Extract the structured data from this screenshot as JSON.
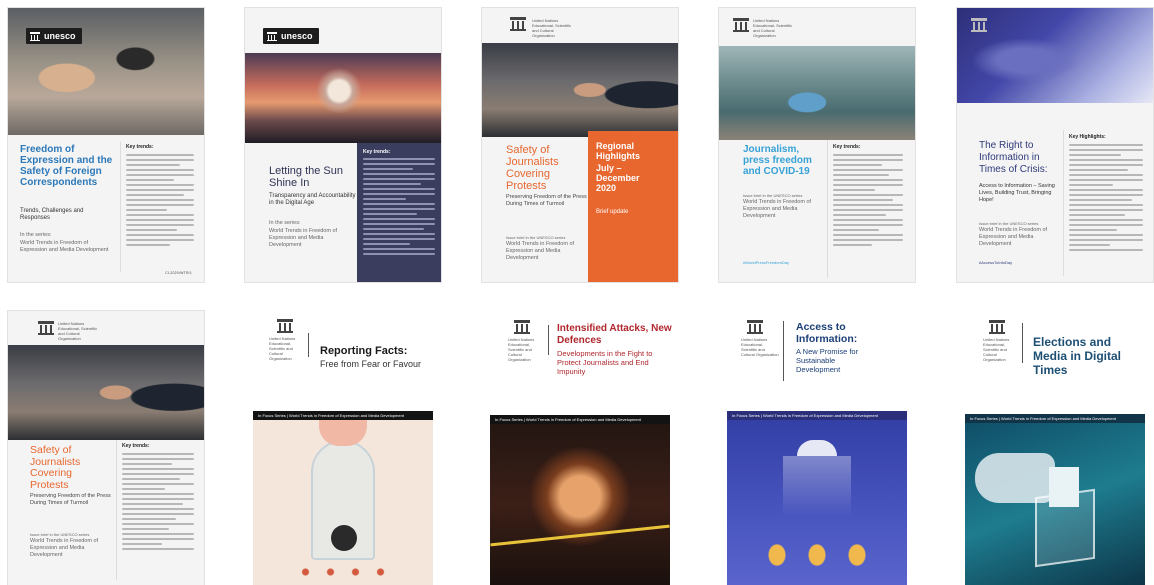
{
  "brand": {
    "logo_text": "unesco",
    "org_lines": "United Nations Educational, Scientific and Cultural Organization"
  },
  "common": {
    "key_trends": "Key trends:",
    "key_highlights": "Key Highlights:",
    "in_series": "In the series:",
    "series_name": "World Trends in Freedom of Expression and Media Development",
    "issue_brief": "Issue brief in the UNESCO series",
    "in_focus_banner": "In Focus Series | World Trends in Freedom of Expression and Media Development",
    "footer": "CI-2020/WTR/1"
  },
  "covers": [
    {
      "title": "Freedom of Expression and the Safety of Foreign Correspondents",
      "subtitle": "Trends, Challenges and Responses"
    },
    {
      "title": "Letting the Sun Shine In",
      "subtitle": "Transparency and Accountability in the Digital Age"
    },
    {
      "title": "Safety of Journalists Covering Protests",
      "subtitle": "Preserving Freedom of the Press During Times of Turmoil",
      "panel_title": "Regional Highlights",
      "panel_date": "July – December 2020",
      "panel_tag": "Brief update"
    },
    {
      "title": "Journalism, press freedom and COVID-19",
      "hashtag": "#WorldPressFreedomDay"
    },
    {
      "title": "The Right to Information in Times of Crisis:",
      "subtitle": "Access to Information – Saving Lives, Building Trust, Bringing Hope!",
      "hashtag": "#AccessToInfoDay"
    },
    {
      "title": "Safety of Journalists Covering Protests",
      "subtitle": "Preserving Freedom of the Press During Times of Turmoil"
    },
    {
      "title": "Reporting Facts:",
      "subtitle": "Free from Fear or Favour"
    },
    {
      "title": "Intensified Attacks, New Defences",
      "subtitle": "Developments in the Fight to Protect Journalists and End Impunity"
    },
    {
      "title": "Access to Information:",
      "subtitle": "A New Promise for Sustainable Development"
    },
    {
      "title": "Elections and Media in Digital Times"
    }
  ],
  "colors": {
    "blue": "#2c78b8",
    "orange": "#e8672f",
    "navy": "#3a3d5e",
    "dark_blue": "#1d4f73",
    "red": "#b0272d"
  }
}
